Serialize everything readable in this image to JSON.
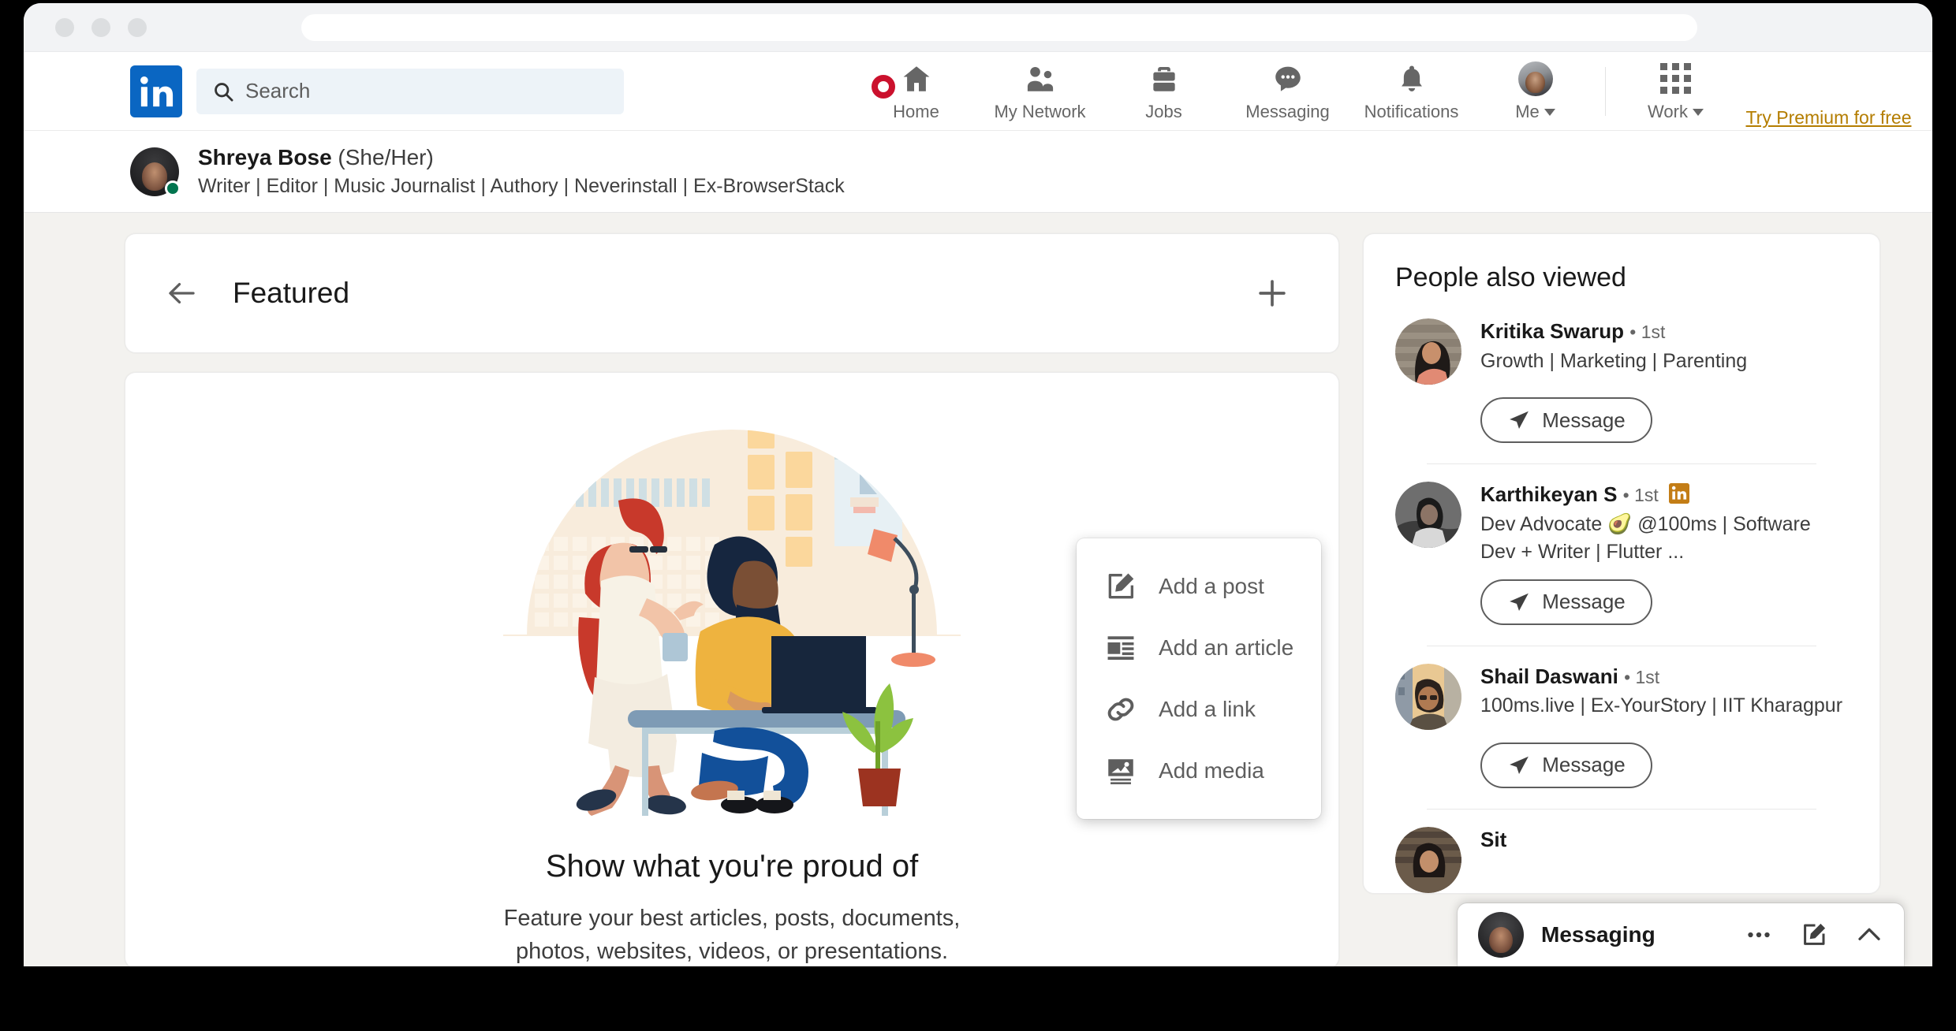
{
  "browser": {
    "traffic_lights": [
      "close",
      "minimize",
      "maximize"
    ],
    "url_value": "",
    "url_placeholder": ""
  },
  "globalnav": {
    "logo_alt": "LinkedIn",
    "search": {
      "placeholder": "Search",
      "value": ""
    },
    "items": [
      {
        "label": "Home",
        "icon": "home-icon",
        "badge": true
      },
      {
        "label": "My Network",
        "icon": "network-icon",
        "badge": false
      },
      {
        "label": "Jobs",
        "icon": "briefcase-icon",
        "badge": false
      },
      {
        "label": "Messaging",
        "icon": "message-bubble-icon",
        "badge": false
      },
      {
        "label": "Notifications",
        "icon": "bell-icon",
        "badge": false
      },
      {
        "label": "Me",
        "icon": "avatar-icon",
        "badge": false,
        "caret": true
      },
      {
        "label": "Work",
        "icon": "grid-icon",
        "badge": false,
        "caret": true
      }
    ],
    "premium_link": "Try Premium for free",
    "premium_color": "#b47d00",
    "brand_color": "#0a66c2",
    "badge_color": "#cb112d"
  },
  "profile_strip": {
    "name": "Shreya Bose",
    "pronouns": "(She/Her)",
    "headline": "Writer | Editor | Music Journalist | Authory | Neverinstall | Ex-BrowserStack",
    "online_color": "#01754f"
  },
  "featured": {
    "title": "Featured",
    "back_icon": "arrow-left-icon",
    "add_icon": "plus-icon",
    "empty_title": "Show what you're proud of",
    "empty_subtitle": "Feature your best articles, posts, documents, photos, websites, videos, or presentations.",
    "illustration_alt": "two coworkers at a desk with laptop"
  },
  "add_menu": {
    "items": [
      {
        "label": "Add a post",
        "icon": "edit-square-icon"
      },
      {
        "label": "Add an article",
        "icon": "article-icon"
      },
      {
        "label": "Add a link",
        "icon": "link-icon"
      },
      {
        "label": "Add media",
        "icon": "image-icon"
      }
    ]
  },
  "sidebar": {
    "title": "People also viewed",
    "people": [
      {
        "name": "Kritika Swarup",
        "degree": "• 1st",
        "headline": "Growth | Marketing | Parenting",
        "message_label": "Message",
        "premium_badge": false
      },
      {
        "name": "Karthikeyan S",
        "degree": "• 1st",
        "headline": "Dev Advocate 🥑 @100ms | Software Dev + Writer | Flutter ...",
        "message_label": "Message",
        "premium_badge": true
      },
      {
        "name": "Shail Daswani",
        "degree": "• 1st",
        "headline": "100ms.live | Ex-YourStory | IIT Kharagpur",
        "message_label": "Message",
        "premium_badge": false
      },
      {
        "name": "Sit",
        "degree": "",
        "headline": "",
        "message_label": "",
        "premium_badge": false
      }
    ]
  },
  "messaging_bar": {
    "title": "Messaging",
    "more_icon": "ellipsis-icon",
    "compose_icon": "compose-icon",
    "expand_icon": "chevron-up-icon"
  }
}
